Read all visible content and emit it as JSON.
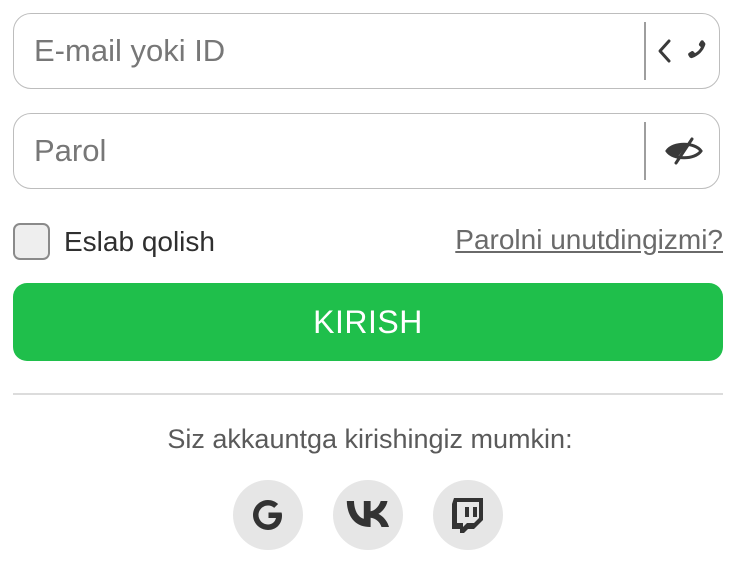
{
  "form": {
    "email_placeholder": "E-mail yoki ID",
    "email_toggle_icon": "phone-switch-icon",
    "password_placeholder": "Parol",
    "password_toggle_icon": "eye-slash-icon",
    "remember_label": "Eslab qolish",
    "remember_checked": false,
    "forgot_link": "Parolni unutdingizmi?",
    "submit_label": "KIRISH",
    "colors": {
      "accent": "#1fbf4b",
      "border": "#bdbdbd",
      "social_bg": "#e6e6e6"
    }
  },
  "social": {
    "caption": "Siz akkauntga kirishingiz mumkin:",
    "providers": [
      {
        "name": "google",
        "icon": "google-icon"
      },
      {
        "name": "vk",
        "icon": "vk-icon"
      },
      {
        "name": "twitch",
        "icon": "twitch-icon"
      }
    ]
  }
}
